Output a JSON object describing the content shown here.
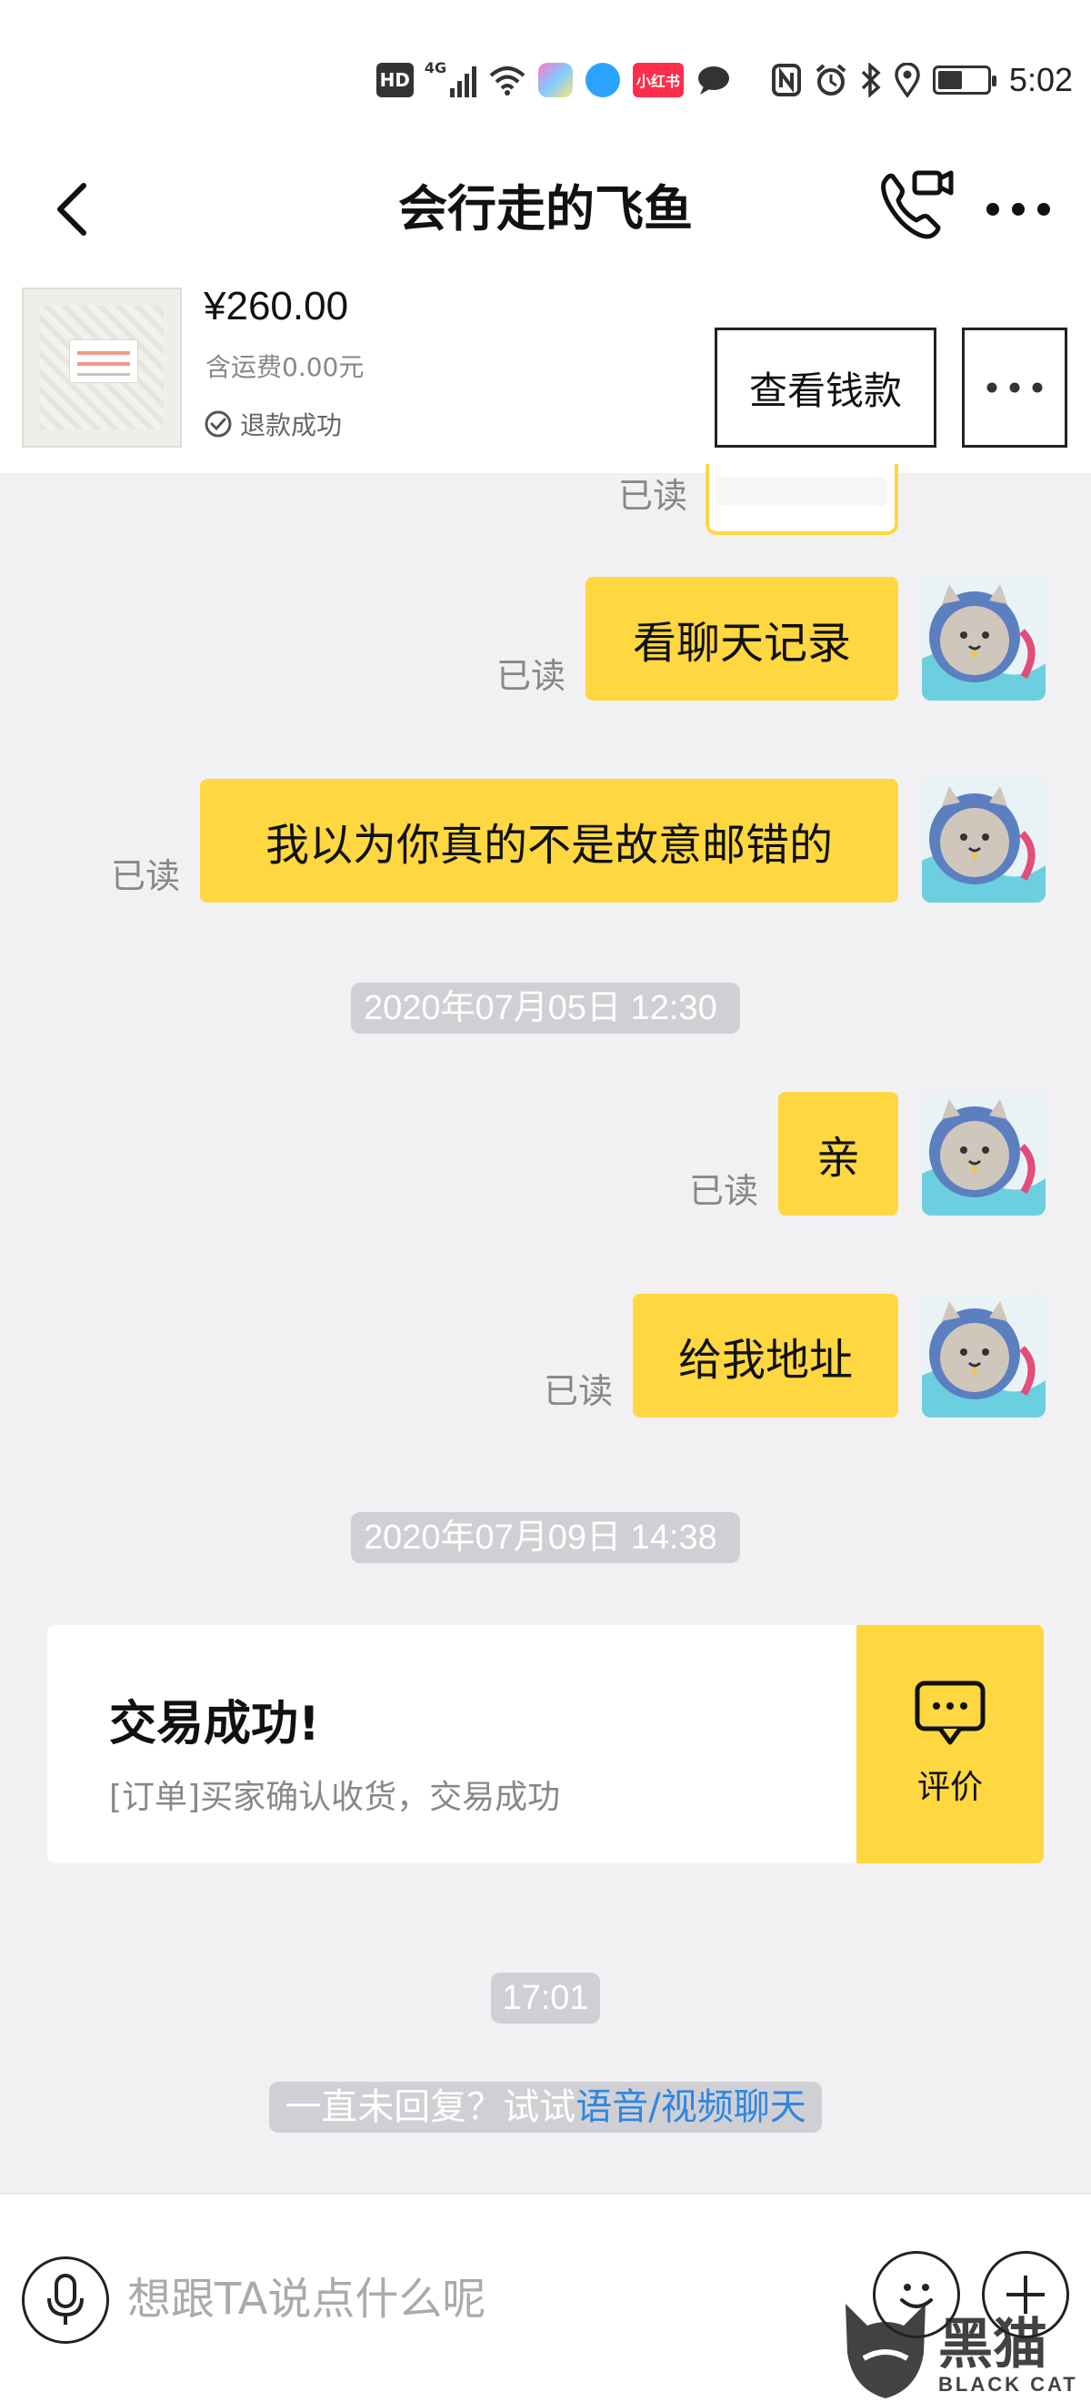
{
  "status_bar": {
    "hd_label": "HD",
    "signal_label": "4G",
    "app_badge_label": "小红书",
    "time": "5:02"
  },
  "header": {
    "title": "会行走的飞鱼"
  },
  "product": {
    "price": "¥260.00",
    "shipping": "含运费0.00元",
    "refund_status": "退款成功",
    "view_payment_button": "查看钱款"
  },
  "chat": {
    "read_label": "已读",
    "messages": [
      {
        "text": "看聊天记录",
        "status": "已读"
      },
      {
        "text": "我以为你真的不是故意邮错的",
        "status": "已读"
      },
      {
        "text": "亲",
        "status": "已读"
      },
      {
        "text": "给我地址",
        "status": "已读"
      }
    ],
    "timestamps": [
      "2020年07月05日 12:30",
      "2020年07月09日 14:38",
      "17:01"
    ],
    "deal_card": {
      "title": "交易成功!",
      "subtitle": "[订单]买家确认收货，交易成功",
      "rate_label": "评价"
    },
    "hint": {
      "prefix": "一直未回复？试试",
      "link": "语音/视频聊天"
    }
  },
  "input": {
    "placeholder": "想跟TA说点什么呢"
  },
  "watermark": {
    "text": "黑猫",
    "sub": "BLACK CAT"
  },
  "colors": {
    "accent": "#ffd740",
    "link": "#2f86e0",
    "background": "#f1f1f4"
  }
}
